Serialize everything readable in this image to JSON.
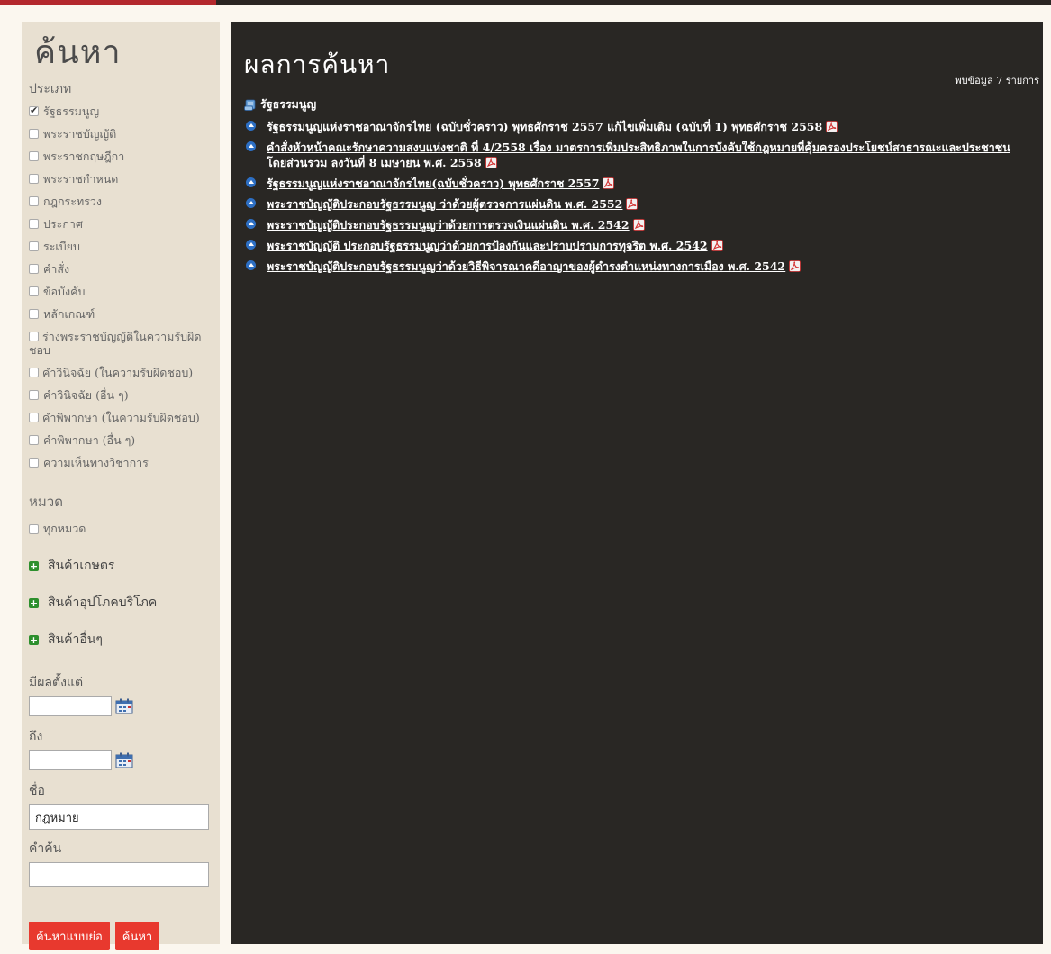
{
  "sidebar": {
    "title": "ค้นหา",
    "type_label": "ประเภท",
    "types": [
      {
        "label": "รัฐธรรมนูญ",
        "checked": true
      },
      {
        "label": "พระราชบัญญัติ",
        "checked": false
      },
      {
        "label": "พระราชกฤษฎีกา",
        "checked": false
      },
      {
        "label": "พระราชกำหนด",
        "checked": false
      },
      {
        "label": "กฎกระทรวง",
        "checked": false
      },
      {
        "label": "ประกาศ",
        "checked": false
      },
      {
        "label": "ระเบียบ",
        "checked": false
      },
      {
        "label": "คำสั่ง",
        "checked": false
      },
      {
        "label": "ข้อบังคับ",
        "checked": false
      },
      {
        "label": "หลักเกณฑ์",
        "checked": false
      },
      {
        "label": "ร่างพระราชบัญญัติในความรับผิดชอบ",
        "checked": false
      },
      {
        "label": "คำวินิจฉัย (ในความรับผิดชอบ)",
        "checked": false
      },
      {
        "label": "คำวินิจฉัย (อื่น ๆ)",
        "checked": false
      },
      {
        "label": "คำพิพากษา (ในความรับผิดชอบ)",
        "checked": false
      },
      {
        "label": "คำพิพากษา (อื่น ๆ)",
        "checked": false
      },
      {
        "label": "ความเห็นทางวิชาการ",
        "checked": false
      }
    ],
    "category_label": "หมวด",
    "category_all": "ทุกหมวด",
    "categories": [
      "สินค้าเกษตร",
      "สินค้าอุปโภคบริโภค",
      "สินค้าอื่นๆ"
    ],
    "from_label": "มีผลตั้งแต่",
    "to_label": "ถึง",
    "name_label": "ชื่อ",
    "name_value": "กฎหมาย",
    "keyword_label": "คำค้น",
    "keyword_value": "",
    "btn_advanced": "ค้นหาแบบย่อ",
    "btn_search": "ค้นหา",
    "calendar_icon": "calendar-icon"
  },
  "main": {
    "title": "ผลการค้นหา",
    "count_text": "พบข้อมูล 7 รายการ",
    "group_label": "รัฐธรรมนูญ",
    "results": [
      "รัฐธรรมนูญแห่งราชอาณาจักรไทย (ฉบับชั่วคราว) พุทธศักราช 2557 แก้ไขเพิ่มเติม (ฉบับที่ 1) พุทธศักราช 2558",
      "คำสั่งหัวหน้าคณะรักษาความสงบแห่งชาติ ที่ 4/2558 เรื่อง มาตรการเพิ่มประสิทธิภาพในการบังคับใช้กฎหมายที่คุ้มครองประโยชน์สาธารณะและประชาชนโดยส่วนรวม ลงวันที่ 8 เมษายน พ.ศ. 2558",
      "รัฐธรรมนูญแห่งราชอาณาจักรไทย(ฉบับชั่วคราว) พุทธศักราช 2557",
      "พระราชบัญญัติประกอบรัฐธรรมนูญ ว่าด้วยผู้ตรวจการแผ่นดิน พ.ศ. 2552",
      "พระราชบัญญัติประกอบรัฐธรรมนูญว่าด้วยการตรวจเงินแผ่นดิน พ.ศ. 2542",
      "พระราชบัญญัติ ประกอบรัฐธรรมนูญว่าด้วยการป้องกันและปราบปรามการทุจริต พ.ศ. 2542",
      "พระราชบัญญัติประกอบรัฐธรรมนูญว่าด้วยวิธีพิจารณาคดีอาญาของผู้ดำรงตำแหน่งทางการเมือง พ.ศ. 2542"
    ]
  }
}
